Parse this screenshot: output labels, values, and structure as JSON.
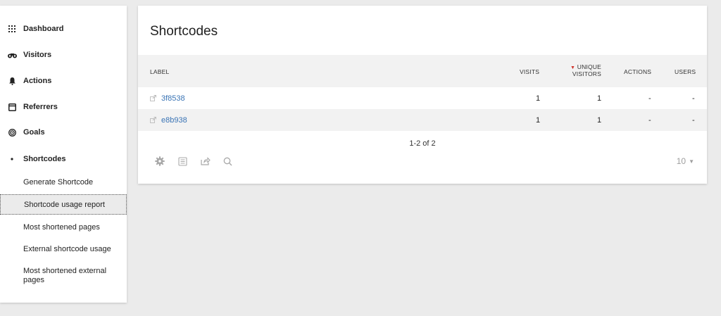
{
  "sidebar": {
    "items": [
      {
        "label": "Dashboard",
        "icon": "grid-icon"
      },
      {
        "label": "Visitors",
        "icon": "binoculars-icon"
      },
      {
        "label": "Actions",
        "icon": "bell-icon"
      },
      {
        "label": "Referrers",
        "icon": "window-icon"
      },
      {
        "label": "Goals",
        "icon": "target-icon"
      },
      {
        "label": "Shortcodes",
        "icon": "bullet-icon"
      }
    ],
    "sub_items": [
      {
        "label": "Generate Shortcode"
      },
      {
        "label": "Shortcode usage report"
      },
      {
        "label": "Most shortened pages"
      },
      {
        "label": "External shortcode usage"
      },
      {
        "label": "Most shortened external pages"
      }
    ]
  },
  "report": {
    "title": "Shortcodes",
    "columns": {
      "label": "LABEL",
      "visits": "VISITS",
      "unique_1": "UNIQUE",
      "unique_2": "VISITORS",
      "actions": "ACTIONS",
      "users": "USERS"
    },
    "rows": [
      {
        "label": "3f8538",
        "visits": "1",
        "unique": "1",
        "actions": "-",
        "users": "-"
      },
      {
        "label": "e8b938",
        "visits": "1",
        "unique": "1",
        "actions": "-",
        "users": "-"
      }
    ],
    "pagination": "1-2 of 2",
    "limit": "10"
  },
  "colors": {
    "link": "#3a74b5",
    "sort_indicator": "#d0342c",
    "background": "#ebebeb"
  }
}
